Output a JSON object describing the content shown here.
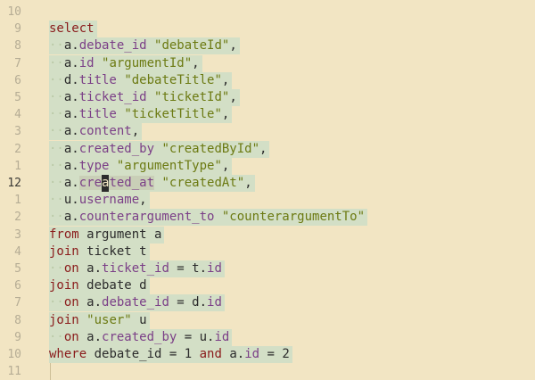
{
  "editor": {
    "lines": [
      {
        "num": "10",
        "current": false,
        "tokens": []
      },
      {
        "num": "9",
        "current": false,
        "tokens": [
          {
            "t": "kw",
            "v": "select"
          }
        ]
      },
      {
        "num": "8",
        "current": false,
        "tokens": [
          {
            "t": "ws",
            "v": "··"
          },
          {
            "t": "plain",
            "v": "a."
          },
          {
            "t": "field",
            "v": "debate_id"
          },
          {
            "t": "plain",
            "v": " "
          },
          {
            "t": "str",
            "v": "\"debateId\""
          },
          {
            "t": "plain",
            "v": ","
          }
        ]
      },
      {
        "num": "7",
        "current": false,
        "tokens": [
          {
            "t": "ws",
            "v": "··"
          },
          {
            "t": "plain",
            "v": "a."
          },
          {
            "t": "field",
            "v": "id"
          },
          {
            "t": "plain",
            "v": " "
          },
          {
            "t": "str",
            "v": "\"argumentId\""
          },
          {
            "t": "plain",
            "v": ","
          }
        ]
      },
      {
        "num": "6",
        "current": false,
        "tokens": [
          {
            "t": "ws",
            "v": "··"
          },
          {
            "t": "plain",
            "v": "d."
          },
          {
            "t": "field",
            "v": "title"
          },
          {
            "t": "plain",
            "v": " "
          },
          {
            "t": "str",
            "v": "\"debateTitle\""
          },
          {
            "t": "plain",
            "v": ","
          }
        ]
      },
      {
        "num": "5",
        "current": false,
        "tokens": [
          {
            "t": "ws",
            "v": "··"
          },
          {
            "t": "plain",
            "v": "a."
          },
          {
            "t": "field",
            "v": "ticket_id"
          },
          {
            "t": "plain",
            "v": " "
          },
          {
            "t": "str",
            "v": "\"ticketId\""
          },
          {
            "t": "plain",
            "v": ","
          }
        ]
      },
      {
        "num": "4",
        "current": false,
        "tokens": [
          {
            "t": "ws",
            "v": "··"
          },
          {
            "t": "plain",
            "v": "a."
          },
          {
            "t": "field",
            "v": "title"
          },
          {
            "t": "plain",
            "v": " "
          },
          {
            "t": "str",
            "v": "\"ticketTitle\""
          },
          {
            "t": "plain",
            "v": ","
          }
        ]
      },
      {
        "num": "3",
        "current": false,
        "tokens": [
          {
            "t": "ws",
            "v": "··"
          },
          {
            "t": "plain",
            "v": "a."
          },
          {
            "t": "field",
            "v": "content"
          },
          {
            "t": "plain",
            "v": ","
          }
        ]
      },
      {
        "num": "2",
        "current": false,
        "tokens": [
          {
            "t": "ws",
            "v": "··"
          },
          {
            "t": "plain",
            "v": "a."
          },
          {
            "t": "field",
            "v": "created_by"
          },
          {
            "t": "plain",
            "v": " "
          },
          {
            "t": "str",
            "v": "\"createdById\""
          },
          {
            "t": "plain",
            "v": ","
          }
        ]
      },
      {
        "num": "1",
        "current": false,
        "tokens": [
          {
            "t": "ws",
            "v": "··"
          },
          {
            "t": "plain",
            "v": "a."
          },
          {
            "t": "field",
            "v": "type"
          },
          {
            "t": "plain",
            "v": " "
          },
          {
            "t": "str",
            "v": "\"argumentType\""
          },
          {
            "t": "plain",
            "v": ","
          }
        ]
      },
      {
        "num": "12",
        "current": true,
        "tokens": [
          {
            "t": "ws",
            "v": "··"
          },
          {
            "t": "plain",
            "v": "a."
          },
          {
            "t": "fieldhl",
            "v": "cre"
          },
          {
            "t": "caret",
            "v": "a"
          },
          {
            "t": "fieldhl",
            "v": "ted_at"
          },
          {
            "t": "plain",
            "v": " "
          },
          {
            "t": "str",
            "v": "\"createdAt\""
          },
          {
            "t": "plain",
            "v": ","
          }
        ]
      },
      {
        "num": "1",
        "current": false,
        "tokens": [
          {
            "t": "ws",
            "v": "··"
          },
          {
            "t": "plain",
            "v": "u."
          },
          {
            "t": "field",
            "v": "username"
          },
          {
            "t": "plain",
            "v": ","
          }
        ]
      },
      {
        "num": "2",
        "current": false,
        "tokens": [
          {
            "t": "ws",
            "v": "··"
          },
          {
            "t": "plain",
            "v": "a."
          },
          {
            "t": "field",
            "v": "counterargument_to"
          },
          {
            "t": "plain",
            "v": " "
          },
          {
            "t": "str",
            "v": "\"counterargumentTo\""
          }
        ]
      },
      {
        "num": "3",
        "current": false,
        "tokens": [
          {
            "t": "kw",
            "v": "from"
          },
          {
            "t": "plain",
            "v": " argument a"
          }
        ]
      },
      {
        "num": "4",
        "current": false,
        "tokens": [
          {
            "t": "kw",
            "v": "join"
          },
          {
            "t": "plain",
            "v": " ticket t"
          }
        ]
      },
      {
        "num": "5",
        "current": false,
        "tokens": [
          {
            "t": "ws",
            "v": "··"
          },
          {
            "t": "kw",
            "v": "on"
          },
          {
            "t": "plain",
            "v": " a."
          },
          {
            "t": "field",
            "v": "ticket_id"
          },
          {
            "t": "plain",
            "v": " = t."
          },
          {
            "t": "field",
            "v": "id"
          }
        ]
      },
      {
        "num": "6",
        "current": false,
        "tokens": [
          {
            "t": "kw",
            "v": "join"
          },
          {
            "t": "plain",
            "v": " debate d"
          }
        ]
      },
      {
        "num": "7",
        "current": false,
        "tokens": [
          {
            "t": "ws",
            "v": "··"
          },
          {
            "t": "kw",
            "v": "on"
          },
          {
            "t": "plain",
            "v": " a."
          },
          {
            "t": "field",
            "v": "debate_id"
          },
          {
            "t": "plain",
            "v": " = d."
          },
          {
            "t": "field",
            "v": "id"
          }
        ]
      },
      {
        "num": "8",
        "current": false,
        "tokens": [
          {
            "t": "kw",
            "v": "join"
          },
          {
            "t": "plain",
            "v": " "
          },
          {
            "t": "str",
            "v": "\"user\""
          },
          {
            "t": "plain",
            "v": " u"
          }
        ]
      },
      {
        "num": "9",
        "current": false,
        "tokens": [
          {
            "t": "ws",
            "v": "··"
          },
          {
            "t": "kw",
            "v": "on"
          },
          {
            "t": "plain",
            "v": " a."
          },
          {
            "t": "field",
            "v": "created_by"
          },
          {
            "t": "plain",
            "v": " = u."
          },
          {
            "t": "field",
            "v": "id"
          }
        ]
      },
      {
        "num": "10",
        "current": false,
        "tokens": [
          {
            "t": "kw",
            "v": "where"
          },
          {
            "t": "plain",
            "v": " debate_id = 1 "
          },
          {
            "t": "kw",
            "v": "and"
          },
          {
            "t": "plain",
            "v": " a."
          },
          {
            "t": "field",
            "v": "id"
          },
          {
            "t": "plain",
            "v": " = 2"
          }
        ]
      },
      {
        "num": "11",
        "current": false,
        "tokens": []
      }
    ]
  },
  "colors": {
    "background": "#f2e5c3",
    "selection": "#d3dfc6",
    "keyword": "#8a1b1b",
    "field": "#7b3f87",
    "string": "#6c7a12",
    "gutter": "#b6ad95"
  }
}
